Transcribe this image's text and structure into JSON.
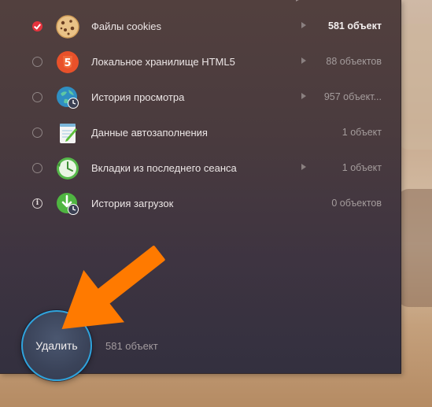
{
  "rows": [
    {
      "label": "Файлы cookies",
      "count": "581 объект",
      "state": "checked",
      "icon": "cookie-icon",
      "arrow": true,
      "bright": true
    },
    {
      "label": "Локальное хранилище HTML5",
      "count": "88 объектов",
      "state": "unchecked",
      "icon": "html5-icon",
      "arrow": true,
      "bright": false
    },
    {
      "label": "История просмотра",
      "count": "957 объект...",
      "state": "unchecked",
      "icon": "history-globe-icon",
      "arrow": true,
      "bright": false
    },
    {
      "label": "Данные автозаполнения",
      "count": "1 объект",
      "state": "unchecked",
      "icon": "autofill-notepad-icon",
      "arrow": false,
      "bright": false
    },
    {
      "label": "Вкладки из последнего сеанса",
      "count": "1 объект",
      "state": "unchecked",
      "icon": "clock-tabs-icon",
      "arrow": true,
      "bright": false
    },
    {
      "label": "История загрузок",
      "count": "0 объектов",
      "state": "info",
      "info_glyph": "i",
      "icon": "download-history-icon",
      "arrow": false,
      "bright": false
    }
  ],
  "delete_button": {
    "label": "Удалить"
  },
  "summary": {
    "text": "581 объект"
  },
  "colors": {
    "accent_red": "#e5333d",
    "button_ring": "#2fa3dc",
    "annotation_arrow": "#ff7a00"
  }
}
